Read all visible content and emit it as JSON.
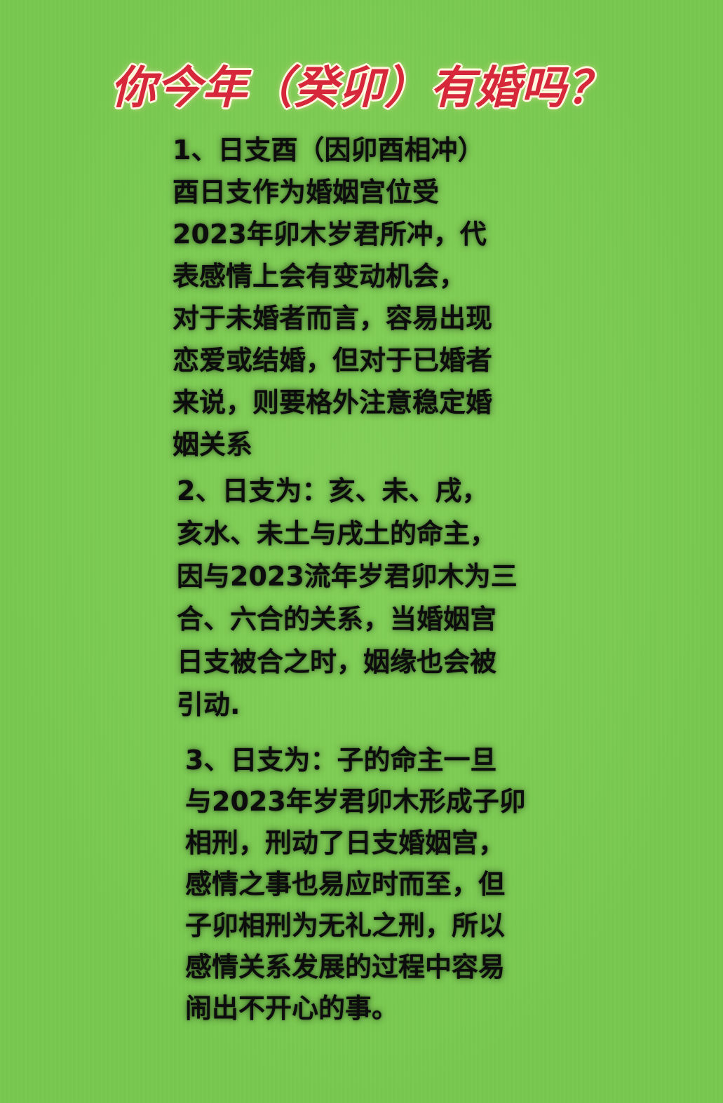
{
  "title": "你今年（癸卯）有婚吗？",
  "sections": [
    {
      "lines": [
        "1、日支酉（因卯酉相冲）",
        "酉日支作为婚姻宫位受",
        "2023年卯木岁君所冲，代",
        "表感情上会有变动机会，",
        "对于未婚者而言，容易出现",
        "恋爱或结婚，但对于已婚者",
        "来说，则要格外注意稳定婚",
        "姻关系"
      ]
    },
    {
      "lines": [
        "2、日支为：亥、未、戌，",
        "亥水、未土与戌土的命主，",
        "因与2023流年岁君卯木为三",
        "合、六合的关系，当婚姻宫",
        "日支被合之时，姻缘也会被",
        "引动."
      ]
    },
    {
      "lines": [
        "3、日支为：子的命主一旦",
        "与2023年岁君卯木形成子卯",
        "相刑，刑动了日支婚姻宫，",
        "感情之事也易应时而至，但",
        "子卯相刑为无礼之刑，所以",
        "感情关系发展的过程中容易",
        "闹出不开心的事。"
      ]
    }
  ],
  "colors": {
    "background": "#78c84f",
    "title": "#d6283a",
    "title_outline": "#fff7e0",
    "text": "#0d0d0d"
  }
}
